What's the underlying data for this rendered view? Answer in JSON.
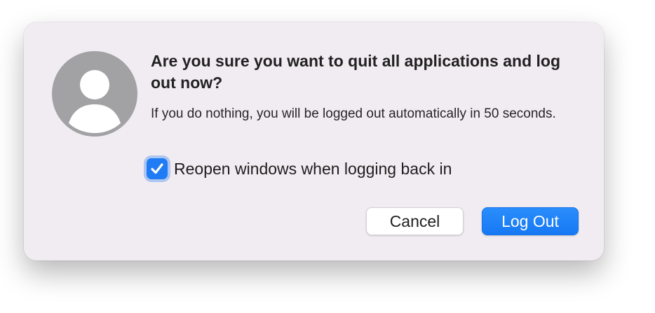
{
  "dialog": {
    "avatar_icon": "user-silhouette-icon",
    "title": "Are you sure you want to quit all applications and log out now?",
    "message": "If you do nothing, you will be logged out automatically in 50 seconds.",
    "checkbox": {
      "label": "Reopen windows when logging back in",
      "checked": true
    },
    "buttons": {
      "cancel_label": "Cancel",
      "logout_label": "Log Out"
    },
    "colors": {
      "background": "#f1ecf1",
      "accent": "#1f7cf5",
      "avatar": "#a2a2a4"
    }
  }
}
